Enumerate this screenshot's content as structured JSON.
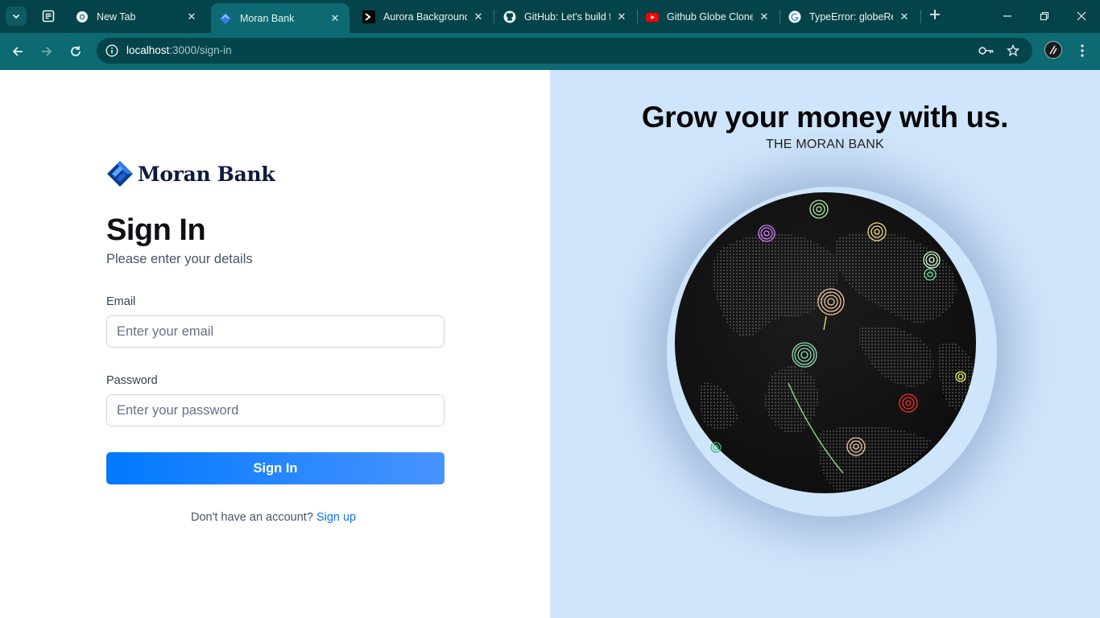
{
  "browser": {
    "tabs": [
      {
        "title": "New Tab",
        "icon": "chrome-icon"
      },
      {
        "title": "Moran Bank",
        "icon": "moran-bank-favicon",
        "active": true
      },
      {
        "title": "Aurora Background",
        "icon": "terminal-prompt-icon"
      },
      {
        "title": "GitHub: Let's build f",
        "icon": "github-icon"
      },
      {
        "title": "Github Globe Clone",
        "icon": "youtube-icon"
      },
      {
        "title": "TypeError: globeRef",
        "icon": "google-icon"
      }
    ],
    "url_host": "localhost",
    "url_path": ":3000/sign-in"
  },
  "brand": {
    "name": "Moran Bank",
    "accent": "#0179fe",
    "logo_dark": "#0b3d91",
    "logo_light": "#2f7ee8"
  },
  "signin": {
    "title": "Sign In",
    "subtitle": "Please enter your details",
    "email_label": "Email",
    "email_placeholder": "Enter your email",
    "email_value": "",
    "password_label": "Password",
    "password_placeholder": "Enter your password",
    "password_value": "",
    "submit_label": "Sign In",
    "footer_text": "Don't have an account?",
    "footer_link": "Sign up"
  },
  "hero": {
    "headline": "Grow your money with us.",
    "subheadline": "THE MORAN BANK",
    "background": "#cfe5fb",
    "globe_color": "#141414"
  }
}
